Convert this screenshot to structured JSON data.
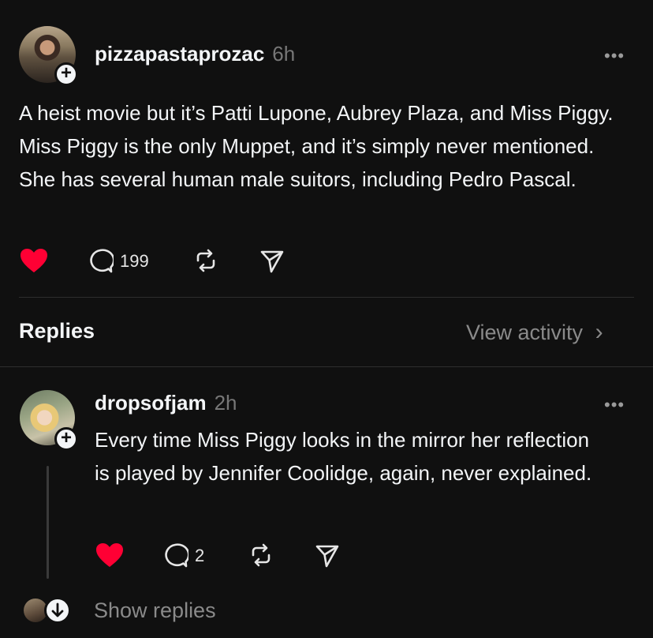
{
  "post": {
    "username": "pizzapastaprozac",
    "time": "6h",
    "more_icon": "•••",
    "text": "A heist movie but it’s Patti Lupone, Aubrey Plaza, and Miss Piggy. Miss Piggy is the only Muppet, and it’s simply never mentioned. She has several human male suitors, including Pedro Pascal.",
    "like_icon": "heart-filled-icon",
    "reply_count": "199",
    "like_color": "#ff0034"
  },
  "replies_header": {
    "title": "Replies",
    "activity_link": "View activity",
    "chevron": "›"
  },
  "reply": {
    "username": "dropsofjam",
    "time": "2h",
    "more_icon": "•••",
    "text": "Every time Miss Piggy looks in the mirror her reflection is played by Jennifer Coolidge, again, never explained.",
    "reply_count": "2"
  },
  "show_replies": {
    "label": "Show replies"
  },
  "follow_badge": "+"
}
